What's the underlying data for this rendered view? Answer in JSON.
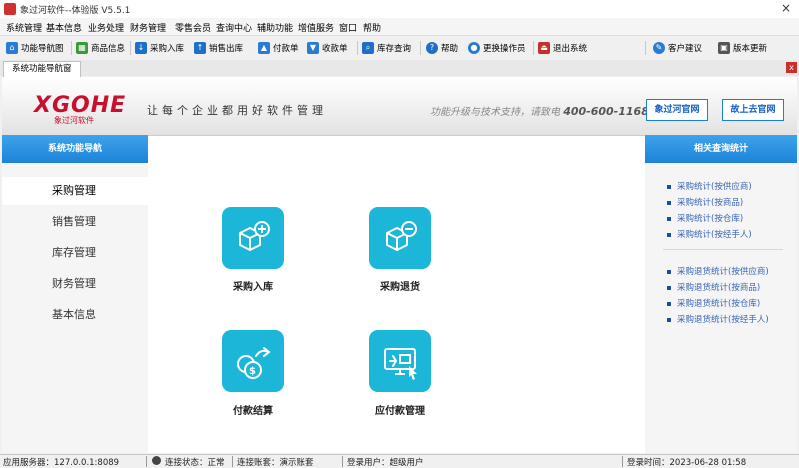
{
  "window": {
    "title": "象过河软件--体验版 V5.5.1",
    "close": "×"
  },
  "menu": [
    "系统管理",
    "基本信息",
    "业务处理",
    "财务管理",
    "零售会员",
    "查询中心",
    "辅助功能",
    "增值服务",
    "窗口",
    "帮助"
  ],
  "toolbar": {
    "items": [
      "功能导航图",
      "商品信息",
      "采购入库",
      "销售出库",
      "付款单",
      "收款单",
      "库存查询",
      "帮助",
      "更换操作员",
      "退出系统"
    ],
    "right_items": [
      "客户建议",
      "版本更新"
    ]
  },
  "tab": {
    "label": "系统功能导航窗",
    "close": "x"
  },
  "banner": {
    "logo": "XGOHE",
    "logo_sub": "象过河软件",
    "slogan": "让每个企业都用好软件管理",
    "hotline_text": "功能升级与技术支持，请致电",
    "hotline_number": "400-600-1168",
    "btn_official": "象过河官网",
    "btn_mall": "故上去官网"
  },
  "left_nav": {
    "header": "系统功能导航",
    "items": [
      "采购管理",
      "销售管理",
      "库存管理",
      "财务管理",
      "基本信息"
    ],
    "active": "采购管理"
  },
  "tiles": [
    {
      "label": "采购入库",
      "icon": "box-plus-icon"
    },
    {
      "label": "采购退货",
      "icon": "box-minus-icon"
    },
    {
      "label": "付款结算",
      "icon": "coins-arrow-icon"
    },
    {
      "label": "应付款管理",
      "icon": "monitor-cash-icon"
    }
  ],
  "right_panel": {
    "header": "相关查询统计",
    "group1": [
      "采购统计(按供应商)",
      "采购统计(按商品)",
      "采购统计(按仓库)",
      "采购统计(按经手人)"
    ],
    "group2": [
      "采购退货统计(按供应商)",
      "采购退货统计(按商品)",
      "采购退货统计(按仓库)",
      "采购退货统计(按经手人)"
    ]
  },
  "status": {
    "server": "应用服务器：127.0.0.1:8089",
    "conn": "连接状态：正常",
    "account": "连接账套：演示账套",
    "user": "登录用户：超级用户",
    "login_time": "登录时间：2023-06-28 01:58"
  },
  "colors": {
    "accent": "#1c83d9",
    "tile": "#1bb6d8",
    "brand": "#c8102e"
  }
}
